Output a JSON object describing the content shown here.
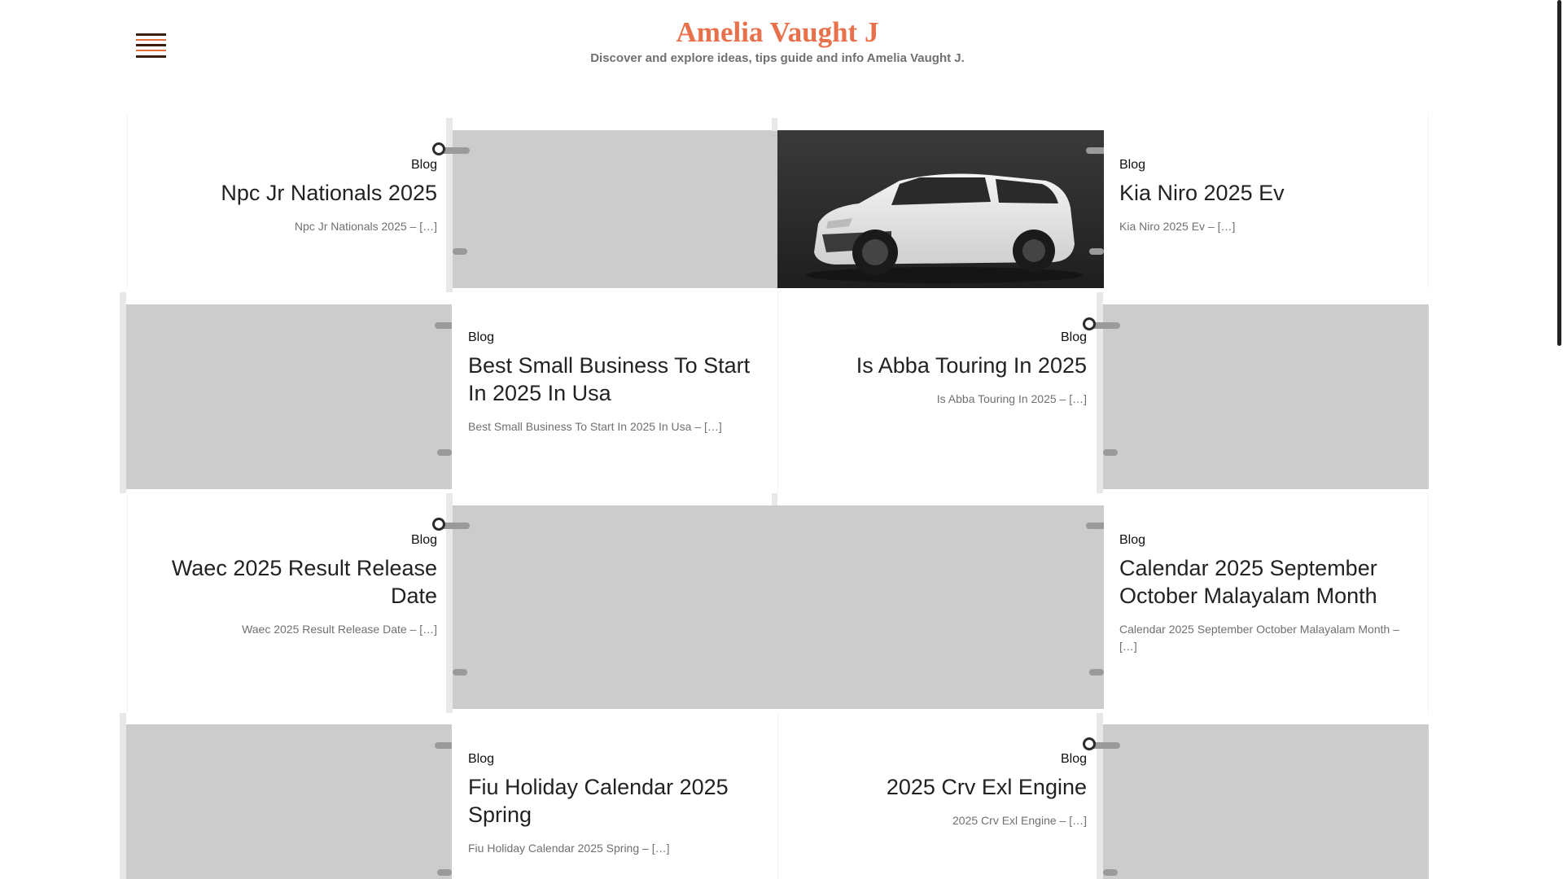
{
  "site": {
    "title": "Amelia Vaught J",
    "description": "Discover and explore ideas, tips guide and info Amelia Vaught J."
  },
  "icons": {
    "menu": "hamburger-menu-icon"
  },
  "colors": {
    "title": "#e8704a",
    "placeholder": "#cccccc"
  },
  "posts": [
    {
      "category": "Blog",
      "title": "Npc Jr Nationals 2025",
      "excerpt": "Npc Jr Nationals 2025 – […]"
    },
    {
      "category": "Blog",
      "title": "Kia Niro 2025 Ev",
      "excerpt": "Kia Niro 2025 Ev – […]"
    },
    {
      "category": "Blog",
      "title": "Best Small Business To Start In 2025 In Usa",
      "excerpt": "Best Small Business To Start In 2025 In Usa – […]"
    },
    {
      "category": "Blog",
      "title": "Is Abba Touring In 2025",
      "excerpt": "Is Abba Touring In 2025 – […]"
    },
    {
      "category": "Blog",
      "title": "Waec 2025 Result Release Date",
      "excerpt": "Waec 2025 Result Release Date – […]"
    },
    {
      "category": "Blog",
      "title": "Calendar 2025 September October Malayalam Month",
      "excerpt": "Calendar 2025 September October Malayalam Month – […]"
    },
    {
      "category": "Blog",
      "title": "Fiu Holiday Calendar 2025 Spring",
      "excerpt": "Fiu Holiday Calendar 2025 Spring – […]"
    },
    {
      "category": "Blog",
      "title": "2025 Crv Exl Engine",
      "excerpt": "2025 Crv Exl Engine – […]"
    }
  ]
}
